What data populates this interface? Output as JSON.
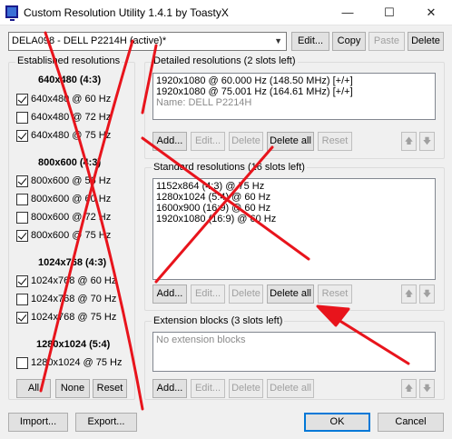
{
  "window": {
    "title": "Custom Resolution Utility 1.4.1 by ToastyX",
    "minimize": "—",
    "maximize": "☐",
    "close": "✕"
  },
  "toolbar": {
    "monitor_selected": "DELA098 - DELL P2214H (active)*",
    "edit": "Edit...",
    "copy": "Copy",
    "paste": "Paste",
    "delete": "Delete"
  },
  "established": {
    "title": "Established resolutions",
    "groups": [
      {
        "heading": "640x480 (4:3)",
        "items": [
          {
            "label": "640x480 @ 60 Hz",
            "checked": true
          },
          {
            "label": "640x480 @ 72 Hz",
            "checked": false
          },
          {
            "label": "640x480 @ 75 Hz",
            "checked": true
          }
        ]
      },
      {
        "heading": "800x600 (4:3)",
        "items": [
          {
            "label": "800x600 @ 56 Hz",
            "checked": true
          },
          {
            "label": "800x600 @ 60 Hz",
            "checked": false
          },
          {
            "label": "800x600 @ 72 Hz",
            "checked": false
          },
          {
            "label": "800x600 @ 75 Hz",
            "checked": true
          }
        ]
      },
      {
        "heading": "1024x768 (4:3)",
        "items": [
          {
            "label": "1024x768 @ 60 Hz",
            "checked": true
          },
          {
            "label": "1024x768 @ 70 Hz",
            "checked": false
          },
          {
            "label": "1024x768 @ 75 Hz",
            "checked": true
          }
        ]
      },
      {
        "heading": "1280x1024 (5:4)",
        "items": [
          {
            "label": "1280x1024 @ 75 Hz",
            "checked": false
          }
        ]
      }
    ],
    "btn_all": "All",
    "btn_none": "None",
    "btn_reset": "Reset"
  },
  "detailed": {
    "title": "Detailed resolutions (2 slots left)",
    "rows": [
      "1920x1080 @ 60.000 Hz (148.50 MHz) [+/+]",
      "1920x1080 @ 75.001 Hz (164.61 MHz) [+/+]",
      "Name: DELL P2214H"
    ],
    "add": "Add...",
    "edit": "Edit...",
    "delete": "Delete",
    "delete_all": "Delete all",
    "reset": "Reset",
    "up": "🡅",
    "down": "🡇"
  },
  "standard": {
    "title": "Standard resolutions (16 slots left)",
    "rows": [
      "1152x864 (4:3) @ 75 Hz",
      "1280x1024 (5:4) @ 60 Hz",
      "1600x900 (16:9) @ 60 Hz",
      "1920x1080 (16:9) @ 60 Hz"
    ],
    "add": "Add...",
    "edit": "Edit...",
    "delete": "Delete",
    "delete_all": "Delete all",
    "reset": "Reset",
    "up": "🡅",
    "down": "🡇"
  },
  "extension": {
    "title": "Extension blocks (3 slots left)",
    "empty_text": "No extension blocks",
    "add": "Add...",
    "edit": "Edit...",
    "delete": "Delete",
    "delete_all": "Delete all",
    "up": "🡅",
    "down": "🡇"
  },
  "footer": {
    "import": "Import...",
    "export": "Export...",
    "ok": "OK",
    "cancel": "Cancel"
  },
  "annotation_color": "#e8141c"
}
